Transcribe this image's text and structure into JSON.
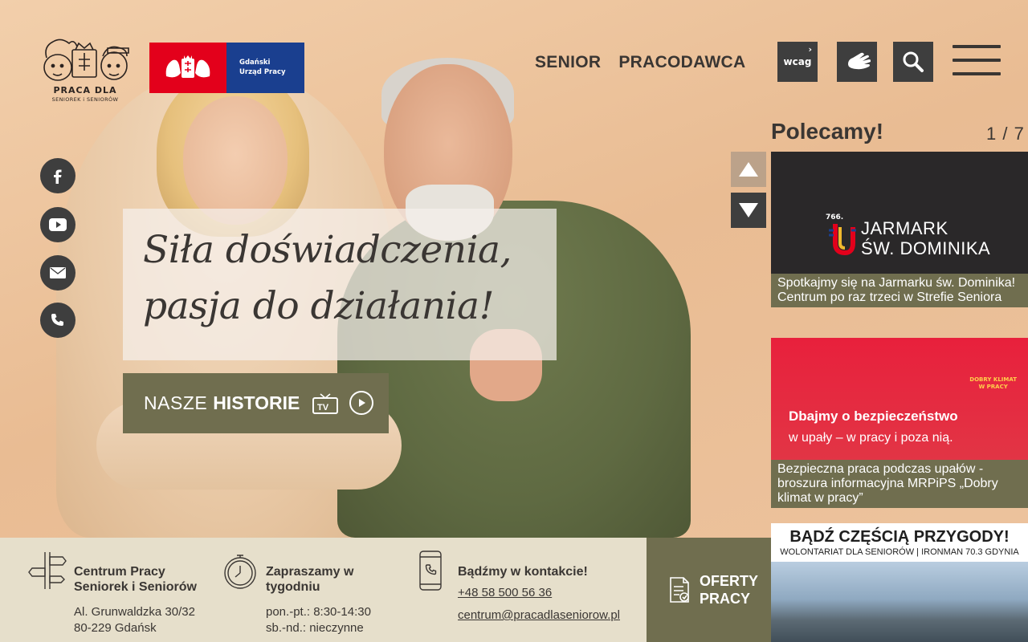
{
  "header": {
    "logo_title": "PRACA DLA",
    "logo_subtitle": "SENIOREK i SENIORÓW",
    "partner_logo_text_line1": "Gdański",
    "partner_logo_text_line2": "Urząd Pracy",
    "nav": [
      "SENIOR",
      "PRACODAWCA"
    ],
    "wcag_label": "wcag",
    "wcag_sup": "›"
  },
  "hero": {
    "headline_line1": "Siła doświadczenia,",
    "headline_line2": "pasja do działania!",
    "stories_prefix": "NASZE",
    "stories_bold": "HISTORIE",
    "stories_tv": "TV"
  },
  "recommended": {
    "title": "Polecamy!",
    "counter": "1 / 7",
    "cards": [
      {
        "img_num": "766.",
        "img_line1": "JARMARK",
        "img_line2": "ŚW. DOMINIKA",
        "caption": "Spotkajmy się na Jarmarku św. Dominika! Centrum po raz trzeci w Strefie Seniora"
      },
      {
        "img_badge_line1": "DOBRY KLIMAT",
        "img_badge_line2": "W PRACY",
        "img_line1": "Dbajmy o bezpieczeństwo",
        "img_line2": "w upały – w pracy i poza nią.",
        "caption": "Bezpieczna praca podczas upałów - broszura informacyjna MRPiPS „Dobry klimat w pracy”"
      },
      {
        "img_line1": "BĄDŹ CZĘŚCIĄ PRZYGODY!",
        "img_line2": "WOLONTARIAT DLA SENIORÓW | IRONMAN 70.3 GDYNIA"
      }
    ]
  },
  "footer": {
    "address_title": "Centrum Pracy Seniorek i Seniorów",
    "address_line1": "Al. Grunwaldzka 30/32",
    "address_line2": "80-229 Gdańsk",
    "hours_title": "Zapraszamy w tygodniu",
    "hours_line1": "pon.-pt.: 8:30-14:30",
    "hours_line2": "sb.-nd.: nieczynne",
    "contact_title": "Bądźmy w kontakcie!",
    "phone": "+48 58 500 56 36",
    "email": "centrum@pracadlaseniorow.pl",
    "offers_line1": "OFERTY",
    "offers_line2": "PRACY"
  },
  "colors": {
    "olive": "#706e4f",
    "dark": "#3e3e3e",
    "footer_bg": "#e6dfcb",
    "gdansk_red": "#e3001b",
    "gdansk_blue": "#1a3f8f"
  }
}
